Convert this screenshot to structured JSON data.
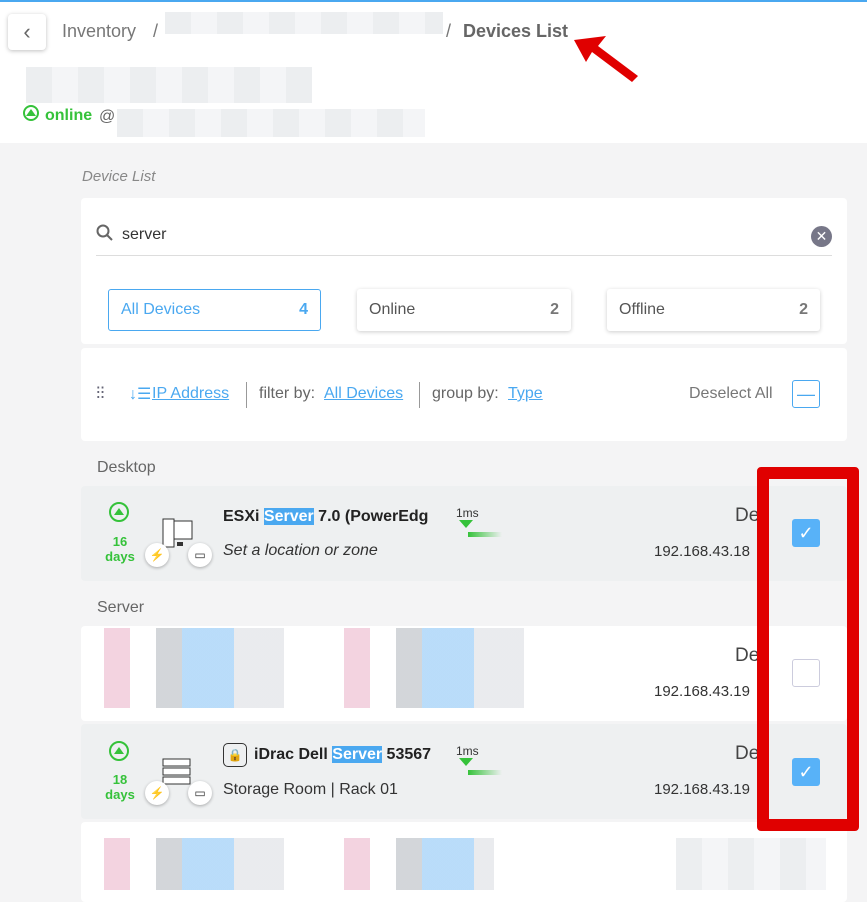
{
  "breadcrumb": {
    "root": "Inventory",
    "sep": "/",
    "sep2": "/",
    "current": "Devices List"
  },
  "status": {
    "label": "online",
    "at": "@"
  },
  "section_label": "Device List",
  "search": {
    "value": "server",
    "placeholder": ""
  },
  "tabs": [
    {
      "label": "All Devices",
      "count": "4",
      "active": true
    },
    {
      "label": "Online",
      "count": "2"
    },
    {
      "label": "Offline",
      "count": "2"
    }
  ],
  "toolbar": {
    "sort": "IP Address",
    "filter_label": "filter by:",
    "filter_value": "All Devices",
    "group_label": "group by:",
    "group_value": "Type",
    "deselect": "Deselect All"
  },
  "groups": {
    "desktop": "Desktop",
    "server": "Server"
  },
  "rows": [
    {
      "uptime": "16",
      "unit": "days",
      "name_pre": "ESXi ",
      "name_hl": "Server",
      "name_post": " 7.0 (PowerEdg",
      "location": "Set a location or zone",
      "latency": "1ms",
      "type": "De",
      "ip": "192.168.43.18",
      "checked": true
    },
    {
      "type": "De",
      "ip": "192.168.43.19",
      "checked": false
    },
    {
      "uptime": "18",
      "unit": "days",
      "name_pre": "iDrac Dell ",
      "name_hl": "Server",
      "name_post": " 53567",
      "location": "Storage Room | Rack 01",
      "latency": "1ms",
      "type": "De",
      "ip": "192.168.43.19",
      "checked": true
    }
  ],
  "colors": {
    "accent": "#4aa8f0",
    "online": "#35c23a",
    "annotation": "#e00000"
  }
}
